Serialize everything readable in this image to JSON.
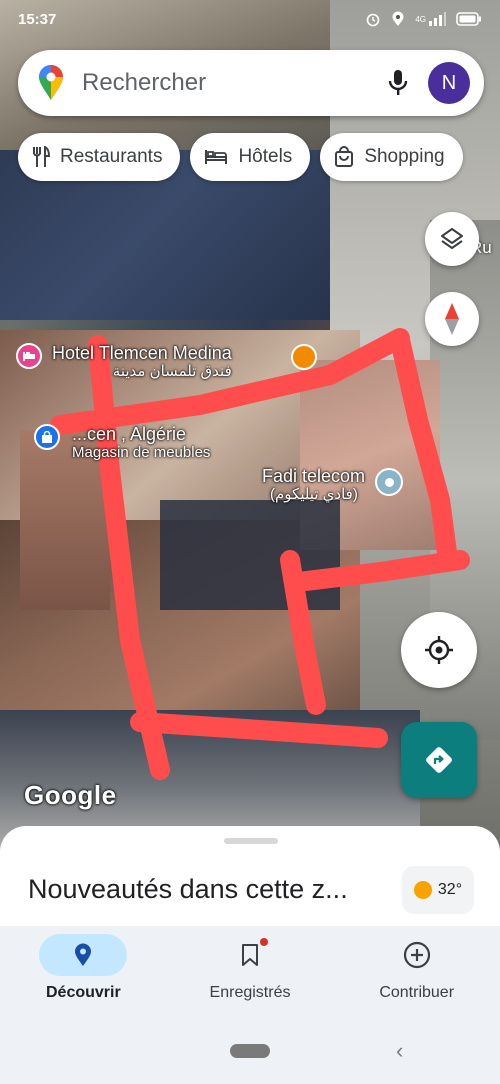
{
  "status_bar": {
    "time": "15:37",
    "network": "4G"
  },
  "search": {
    "placeholder": "Rechercher",
    "avatar_initial": "N"
  },
  "chips": [
    {
      "label": "Restaurants",
      "icon": "restaurant-icon"
    },
    {
      "label": "Hôtels",
      "icon": "hotel-icon"
    },
    {
      "label": "Shopping",
      "icon": "shopping-icon"
    }
  ],
  "map": {
    "street_fragment": "Ru",
    "places": [
      {
        "name": "Hotel Tlemcen Medina",
        "subtitle": "فندق تلمسان مدينة",
        "category": "hotel"
      },
      {
        "name": "...cen , Algérie",
        "subtitle": "Magasin de meubles",
        "category": "shopping"
      },
      {
        "name": "Fadi telecom",
        "subtitle": "(فادي تيليكوم)",
        "category": "place"
      }
    ],
    "logo": "Google",
    "annotation_color": "#ff4d4d"
  },
  "sheet": {
    "title": "Nouveautés dans cette z...",
    "temperature": "32°"
  },
  "bottom_nav": [
    {
      "label": "Découvrir",
      "icon": "explore-pin-icon",
      "active": true
    },
    {
      "label": "Enregistrés",
      "icon": "bookmark-icon",
      "active": false
    },
    {
      "label": "Contribuer",
      "icon": "add-circle-icon",
      "active": false
    }
  ],
  "colors": {
    "accent": "#1a73e8",
    "directions": "#0b7e7d",
    "avatar": "#4a2e9c"
  }
}
